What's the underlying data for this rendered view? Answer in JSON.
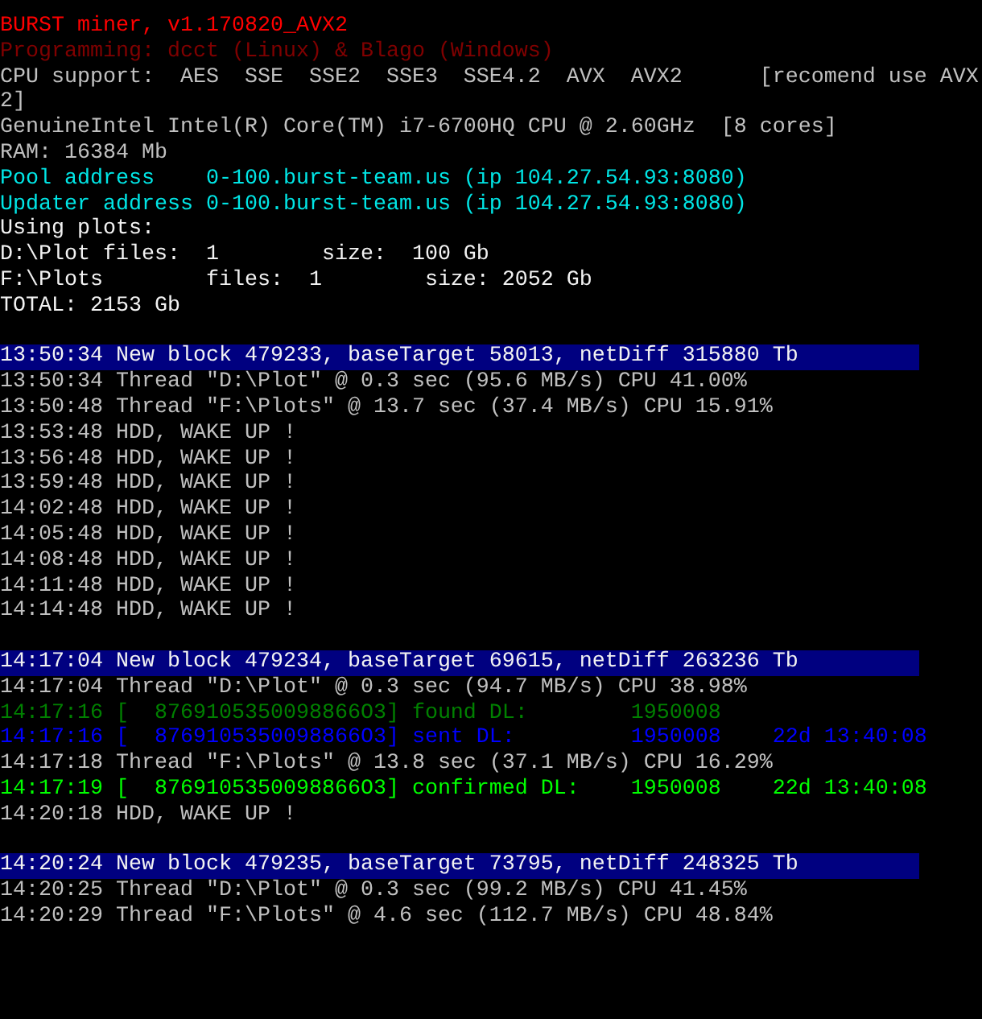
{
  "console": {
    "lines": [
      {
        "kind": "title",
        "text": "BURST miner, v1.170820_AVX2"
      },
      {
        "kind": "credit",
        "text": "Programming: dcct (Linux) & Blago (Windows)"
      },
      {
        "kind": "plain",
        "text": "CPU support:  AES  SSE  SSE2  SSE3  SSE4.2  AVX  AVX2      [recomend use AVX"
      },
      {
        "kind": "plain",
        "text": "2]"
      },
      {
        "kind": "plain",
        "text": "GenuineIntel Intel(R) Core(TM) i7-6700HQ CPU @ 2.60GHz  [8 cores]"
      },
      {
        "kind": "plain",
        "text": "RAM: 16384 Mb"
      },
      {
        "kind": "info",
        "text": "Pool address    0-100.burst-team.us (ip 104.27.54.93:8080)"
      },
      {
        "kind": "info",
        "text": "Updater address 0-100.burst-team.us (ip 104.27.54.93:8080)"
      },
      {
        "kind": "bright",
        "text": "Using plots:"
      },
      {
        "kind": "bright",
        "text": "D:\\Plot files:  1        size:  100 Gb"
      },
      {
        "kind": "bright",
        "text": "F:\\Plots        files:  1        size: 2052 Gb"
      },
      {
        "kind": "bright",
        "text": "TOTAL: 2153 Gb"
      },
      {
        "kind": "blank"
      },
      {
        "kind": "block",
        "text": "13:50:34 New block 479233, baseTarget 58013, netDiff 315880 Tb"
      },
      {
        "kind": "plain",
        "text": "13:50:34 Thread \"D:\\Plot\" @ 0.3 sec (95.6 MB/s) CPU 41.00%"
      },
      {
        "kind": "plain",
        "text": "13:50:48 Thread \"F:\\Plots\" @ 13.7 sec (37.4 MB/s) CPU 15.91%"
      },
      {
        "kind": "plain",
        "text": "13:53:48 HDD, WAKE UP !"
      },
      {
        "kind": "plain",
        "text": "13:56:48 HDD, WAKE UP !"
      },
      {
        "kind": "plain",
        "text": "13:59:48 HDD, WAKE UP !"
      },
      {
        "kind": "plain",
        "text": "14:02:48 HDD, WAKE UP !"
      },
      {
        "kind": "plain",
        "text": "14:05:48 HDD, WAKE UP !"
      },
      {
        "kind": "plain",
        "text": "14:08:48 HDD, WAKE UP !"
      },
      {
        "kind": "plain",
        "text": "14:11:48 HDD, WAKE UP !"
      },
      {
        "kind": "plain",
        "text": "14:14:48 HDD, WAKE UP !"
      },
      {
        "kind": "blank"
      },
      {
        "kind": "block",
        "text": "14:17:04 New block 479234, baseTarget 69615, netDiff 263236 Tb"
      },
      {
        "kind": "plain",
        "text": "14:17:04 Thread \"D:\\Plot\" @ 0.3 sec (94.7 MB/s) CPU 38.98%"
      },
      {
        "kind": "found",
        "text": "14:17:16 [  8769105350098866O3] found DL:        1950008"
      },
      {
        "kind": "sent",
        "text": "14:17:16 [  8769105350098866O3] sent DL:         1950008    22d 13:40:08"
      },
      {
        "kind": "plain",
        "text": "14:17:18 Thread \"F:\\Plots\" @ 13.8 sec (37.1 MB/s) CPU 16.29%"
      },
      {
        "kind": "confirmed",
        "text": "14:17:19 [  8769105350098866O3] confirmed DL:    1950008    22d 13:40:08"
      },
      {
        "kind": "plain",
        "text": "14:20:18 HDD, WAKE UP !"
      },
      {
        "kind": "blank"
      },
      {
        "kind": "block",
        "text": "14:20:24 New block 479235, baseTarget 73795, netDiff 248325 Tb"
      },
      {
        "kind": "plain",
        "text": "14:20:25 Thread \"D:\\Plot\" @ 0.3 sec (99.2 MB/s) CPU 41.45%"
      },
      {
        "kind": "plain",
        "text": "14:20:29 Thread \"F:\\Plots\" @ 4.6 sec (112.7 MB/s) CPU 48.84%"
      }
    ]
  }
}
